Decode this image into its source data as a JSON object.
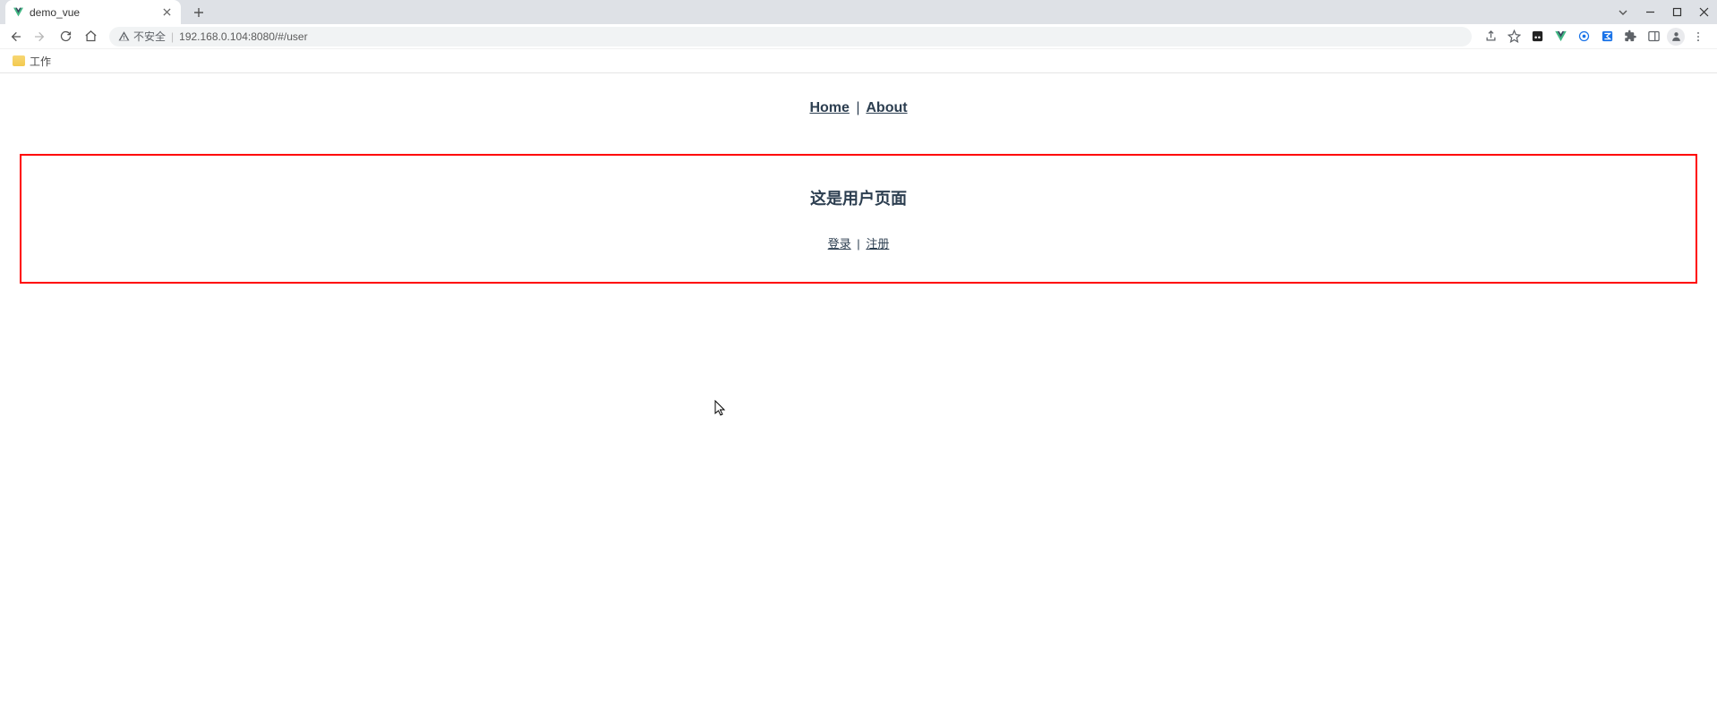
{
  "browser": {
    "tab_title": "demo_vue",
    "security_label": "不安全",
    "url": "192.168.0.104:8080/#/user"
  },
  "bookmarks": {
    "work_folder": "工作"
  },
  "page": {
    "nav_home": "Home",
    "nav_about": "About",
    "nav_separator": "|",
    "heading": "这是用户页面",
    "login_link": "登录",
    "register_link": "注册",
    "sub_separator": "|"
  }
}
